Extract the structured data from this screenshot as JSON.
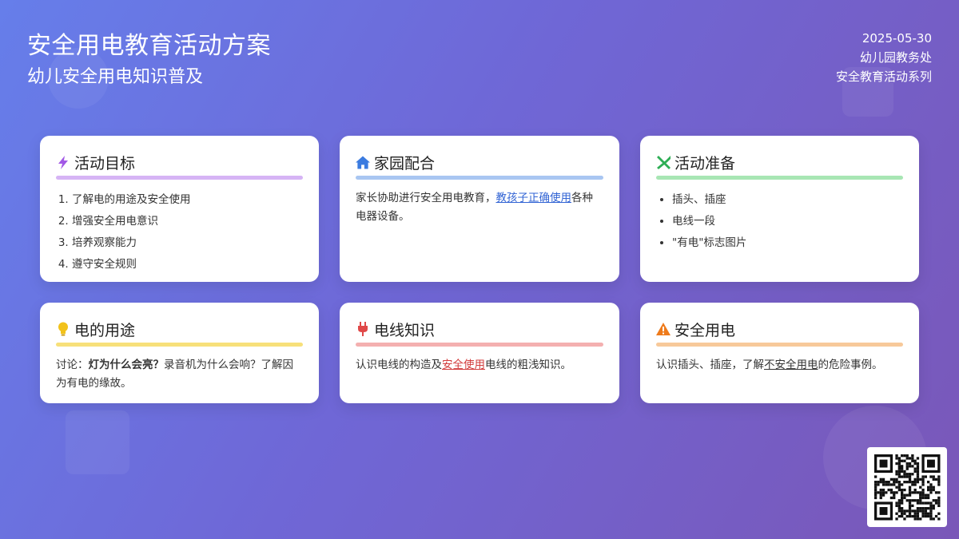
{
  "header": {
    "title": "安全用电教育活动方案",
    "subtitle": "幼儿安全用电知识普及",
    "date": "2025-05-30",
    "org": "幼儿园教务处",
    "series": "安全教育活动系列"
  },
  "cards": {
    "goals": {
      "title": "活动目标",
      "icon": "lightning-icon",
      "color": "#d6b4f5",
      "items": [
        "了解电的用途及安全使用",
        "增强安全用电意识",
        "培养观察能力",
        "遵守安全规则"
      ]
    },
    "home": {
      "title": "家园配合",
      "icon": "home-icon",
      "color": "#a9c6f2",
      "text_before": "家长协助进行安全用电教育，",
      "text_link": "教孩子正确使用",
      "text_after": "各种电器设备。"
    },
    "prep": {
      "title": "活动准备",
      "icon": "tools-icon",
      "color": "#a8e6b4",
      "items": [
        "插头、插座",
        "电线一段",
        "\"有电\"标志图片"
      ]
    },
    "uses": {
      "title": "电的用途",
      "icon": "lightbulb-icon",
      "color": "#f7e07a",
      "text_before": "讨论：",
      "text_bold": "灯为什么会亮？",
      "text_after": "录音机为什么会响？了解因为有电的缘故。"
    },
    "wire": {
      "title": "电线知识",
      "icon": "plug-icon",
      "color": "#f4b0b0",
      "text_before": "认识电线的构造及",
      "text_link": "安全使用",
      "text_after": "电线的粗浅知识。"
    },
    "safety": {
      "title": "安全用电",
      "icon": "warning-icon",
      "color": "#f7c99a",
      "text_before": "认识插头、插座，了解",
      "text_link": "不安全用电",
      "text_after": "的危险事例。"
    }
  },
  "qr": {
    "icon": "qr-code-icon"
  }
}
